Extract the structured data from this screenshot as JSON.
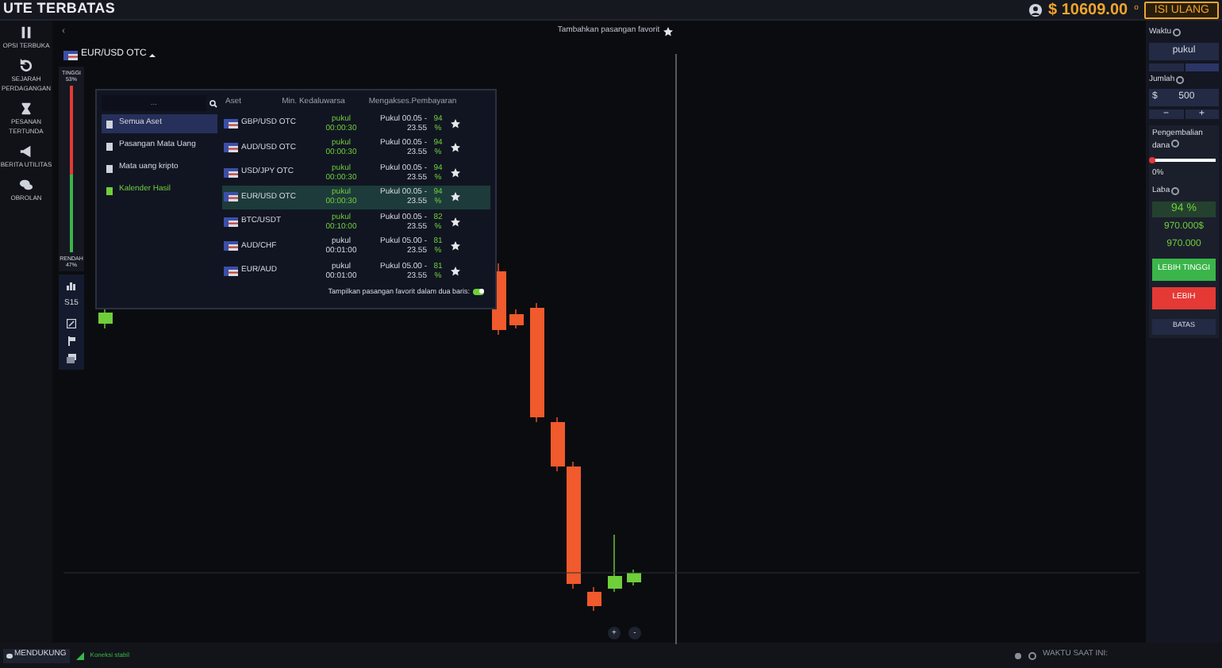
{
  "brand": "UTE TERBATAS",
  "balance": {
    "amount": "$ 10609.00",
    "suffix": "o"
  },
  "refill_button": "ISI ULANG",
  "sidebar": [
    {
      "label": "OPSI TERBUKA"
    },
    {
      "label": "SEJARAH PERDAGANGAN"
    },
    {
      "label": "PESANAN TERTUNDA"
    },
    {
      "label": "BERITA UTILITAS"
    },
    {
      "label": "OBROLAN"
    }
  ],
  "back_arrow": "‹",
  "favorite_hint": "Tambahkan pasangan favorit",
  "asset": "EUR/USD OTC",
  "sentiment": {
    "high_label": "TINGGI",
    "high_value": "53%",
    "low_label": "RENDAH",
    "low_value": "47%",
    "level": 0.53
  },
  "timeframe": "S15",
  "dropdown": {
    "search_placeholder": "...",
    "categories": [
      {
        "label": "Semua Aset",
        "kind": "all",
        "selected": true
      },
      {
        "label": "Pasangan Mata Uang",
        "kind": "currency",
        "selected": false
      },
      {
        "label": "Mata uang kripto",
        "kind": "crypto",
        "selected": false
      },
      {
        "label": "Kalender Hasil",
        "kind": "calendar",
        "selected": false
      }
    ],
    "columns": [
      "Aset",
      "Min. Kedaluwarsa",
      "Mengakses.Pembayaran"
    ],
    "rows": [
      {
        "name": "GBP/USD OTC",
        "expiry_label": "pukul",
        "expiry": "00:00:30",
        "hours": "Pukul 00.05 - 23.55",
        "payout": "94 %",
        "active": true,
        "selected": false
      },
      {
        "name": "AUD/USD OTC",
        "expiry_label": "pukul",
        "expiry": "00:00:30",
        "hours": "Pukul 00.05 - 23.55",
        "payout": "94 %",
        "active": true,
        "selected": false
      },
      {
        "name": "USD/JPY OTC",
        "expiry_label": "pukul",
        "expiry": "00:00:30",
        "hours": "Pukul 00.05 - 23.55",
        "payout": "94 %",
        "active": true,
        "selected": false
      },
      {
        "name": "EUR/USD OTC",
        "expiry_label": "pukul",
        "expiry": "00:00:30",
        "hours": "Pukul 00.05 - 23.55",
        "payout": "94 %",
        "active": true,
        "selected": true
      },
      {
        "name": "BTC/USDT",
        "expiry_label": "pukul",
        "expiry": "00:10:00",
        "hours": "Pukul 00.05 - 23.55",
        "payout": "82 %",
        "active": true,
        "selected": false
      },
      {
        "name": "AUD/CHF",
        "expiry_label": "pukul",
        "expiry": "00:01:00",
        "hours": "Pukul 05.00 - 23.55",
        "payout": "81 %",
        "active": false,
        "selected": false
      },
      {
        "name": "EUR/AUD",
        "expiry_label": "pukul",
        "expiry": "00:01:00",
        "hours": "Pukul 05.00 - 23.55",
        "payout": "81 %",
        "active": false,
        "selected": false
      }
    ],
    "toggle": {
      "label": "Tampilkan pasangan favorit dalam dua baris:",
      "on": true
    }
  },
  "zoom_buttons": [
    "+",
    "-"
  ],
  "panel": {
    "time_label": "Waktu",
    "time_value": "pukul",
    "amount_label": "Jumlah",
    "currency": "$",
    "amount": "500",
    "minus": "−",
    "plus": "+",
    "refund": {
      "label": "Pengembalian dana",
      "level": 0,
      "value": "0%"
    },
    "profit_label": "Laba",
    "profit_percent": "94 %",
    "profit_amount": "970.000$",
    "profit_total": "970.000",
    "higher": "LEBIH TINGGI",
    "lower": "LEBIH",
    "limit": "BATAS"
  },
  "status_bar": {
    "support": "MENDUKUNG",
    "connection": "Koneksi stabil",
    "time_label": "WAKTU SAAT INI:"
  }
}
